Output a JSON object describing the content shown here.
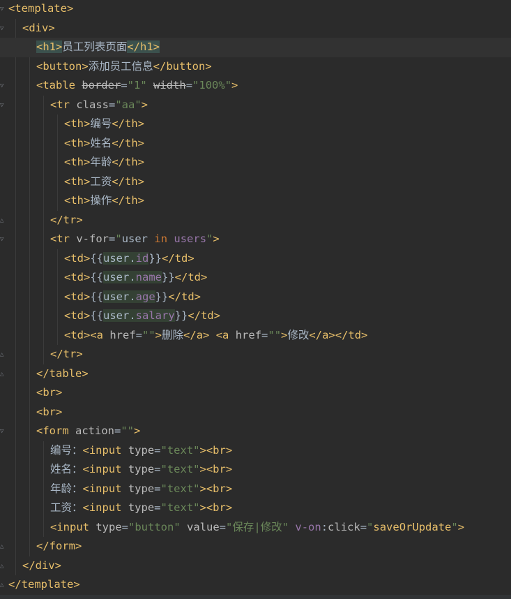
{
  "editor": {
    "lines": [
      {
        "indent": 0,
        "parts": [
          [
            "t",
            "<template>"
          ]
        ]
      },
      {
        "indent": 1,
        "parts": [
          [
            "t",
            "<div>"
          ]
        ]
      },
      {
        "indent": 2,
        "current": true,
        "parts": [
          [
            "t",
            "<h1>",
            "tagmatch"
          ],
          [
            "p",
            "员工列表页面"
          ],
          [
            "t",
            "</h1>",
            "tagmatch"
          ]
        ]
      },
      {
        "indent": 2,
        "parts": [
          [
            "t",
            "<button>"
          ],
          [
            "p",
            "添加员工信息"
          ],
          [
            "t",
            "</button>"
          ]
        ]
      },
      {
        "indent": 2,
        "parts": [
          [
            "t",
            "<table "
          ],
          [
            "strike",
            "border"
          ],
          [
            "p",
            "="
          ],
          [
            "s",
            "\"1\""
          ],
          [
            "p",
            " "
          ],
          [
            "strike",
            "width"
          ],
          [
            "p",
            "="
          ],
          [
            "s",
            "\"100%\""
          ],
          [
            "t",
            ">"
          ]
        ]
      },
      {
        "indent": 3,
        "parts": [
          [
            "t",
            "<tr "
          ],
          [
            "a",
            "class"
          ],
          [
            "p",
            "="
          ],
          [
            "s",
            "\"aa\""
          ],
          [
            "t",
            ">"
          ]
        ]
      },
      {
        "indent": 4,
        "parts": [
          [
            "t",
            "<th>"
          ],
          [
            "p",
            "编号"
          ],
          [
            "t",
            "</th>"
          ]
        ]
      },
      {
        "indent": 4,
        "parts": [
          [
            "t",
            "<th>"
          ],
          [
            "p",
            "姓名"
          ],
          [
            "t",
            "</th>"
          ]
        ]
      },
      {
        "indent": 4,
        "parts": [
          [
            "t",
            "<th>"
          ],
          [
            "p",
            "年龄"
          ],
          [
            "t",
            "</th>"
          ]
        ]
      },
      {
        "indent": 4,
        "parts": [
          [
            "t",
            "<th>"
          ],
          [
            "p",
            "工资"
          ],
          [
            "t",
            "</th>"
          ]
        ]
      },
      {
        "indent": 4,
        "parts": [
          [
            "t",
            "<th>"
          ],
          [
            "p",
            "操作"
          ],
          [
            "t",
            "</th>"
          ]
        ]
      },
      {
        "indent": 3,
        "parts": [
          [
            "t",
            "</tr>"
          ]
        ]
      },
      {
        "indent": 3,
        "parts": [
          [
            "t",
            "<tr "
          ],
          [
            "a",
            "v-for"
          ],
          [
            "p",
            "="
          ],
          [
            "s",
            "\""
          ],
          [
            "p",
            "user "
          ],
          [
            "k",
            "in"
          ],
          [
            "p",
            " "
          ],
          [
            "v",
            "users"
          ],
          [
            "s",
            "\""
          ],
          [
            "t",
            ">"
          ]
        ]
      },
      {
        "indent": 4,
        "parts": [
          [
            "t",
            "<td>"
          ],
          [
            "p",
            "{{"
          ],
          [
            "p",
            "user.",
            "hl"
          ],
          [
            "v",
            "id",
            "hl"
          ],
          [
            "p",
            "}}"
          ],
          [
            "t",
            "</td>"
          ]
        ]
      },
      {
        "indent": 4,
        "parts": [
          [
            "t",
            "<td>"
          ],
          [
            "p",
            "{{"
          ],
          [
            "p",
            "user.",
            "hl"
          ],
          [
            "v",
            "name",
            "hl"
          ],
          [
            "p",
            "}}"
          ],
          [
            "t",
            "</td>"
          ]
        ]
      },
      {
        "indent": 4,
        "parts": [
          [
            "t",
            "<td>"
          ],
          [
            "p",
            "{{"
          ],
          [
            "p",
            "user.",
            "hl"
          ],
          [
            "v",
            "age",
            "hl"
          ],
          [
            "p",
            "}}"
          ],
          [
            "t",
            "</td>"
          ]
        ]
      },
      {
        "indent": 4,
        "parts": [
          [
            "t",
            "<td>"
          ],
          [
            "p",
            "{{"
          ],
          [
            "p",
            "user.",
            "hl"
          ],
          [
            "v",
            "salary",
            "hl"
          ],
          [
            "p",
            "}}"
          ],
          [
            "t",
            "</td>"
          ]
        ]
      },
      {
        "indent": 4,
        "parts": [
          [
            "t",
            "<td><a "
          ],
          [
            "a",
            "href"
          ],
          [
            "p",
            "="
          ],
          [
            "s",
            "\"\""
          ],
          [
            "t",
            ">"
          ],
          [
            "p",
            "删除"
          ],
          [
            "t",
            "</a>"
          ],
          [
            "p",
            " "
          ],
          [
            "t",
            "<a "
          ],
          [
            "a",
            "href"
          ],
          [
            "p",
            "="
          ],
          [
            "s",
            "\"\""
          ],
          [
            "t",
            ">"
          ],
          [
            "p",
            "修改"
          ],
          [
            "t",
            "</a></td>"
          ]
        ]
      },
      {
        "indent": 3,
        "parts": [
          [
            "t",
            "</tr>"
          ]
        ]
      },
      {
        "indent": 2,
        "parts": [
          [
            "t",
            "</table>"
          ]
        ]
      },
      {
        "indent": 2,
        "parts": [
          [
            "t",
            "<br>"
          ]
        ]
      },
      {
        "indent": 2,
        "parts": [
          [
            "t",
            "<br>"
          ]
        ]
      },
      {
        "indent": 2,
        "parts": [
          [
            "t",
            "<form "
          ],
          [
            "a",
            "action"
          ],
          [
            "p",
            "="
          ],
          [
            "s",
            "\"\""
          ],
          [
            "t",
            ">"
          ]
        ]
      },
      {
        "indent": 3,
        "parts": [
          [
            "p",
            "编号："
          ],
          [
            "t",
            "<input "
          ],
          [
            "a",
            "type"
          ],
          [
            "p",
            "="
          ],
          [
            "s",
            "\"text\""
          ],
          [
            "t",
            "><br>"
          ]
        ]
      },
      {
        "indent": 3,
        "parts": [
          [
            "p",
            "姓名："
          ],
          [
            "t",
            "<input "
          ],
          [
            "a",
            "type"
          ],
          [
            "p",
            "="
          ],
          [
            "s",
            "\"text\""
          ],
          [
            "t",
            "><br>"
          ]
        ]
      },
      {
        "indent": 3,
        "parts": [
          [
            "p",
            "年龄："
          ],
          [
            "t",
            "<input "
          ],
          [
            "a",
            "type"
          ],
          [
            "p",
            "="
          ],
          [
            "s",
            "\"text\""
          ],
          [
            "t",
            "><br>"
          ]
        ]
      },
      {
        "indent": 3,
        "parts": [
          [
            "p",
            "工资："
          ],
          [
            "t",
            "<input "
          ],
          [
            "a",
            "type"
          ],
          [
            "p",
            "="
          ],
          [
            "s",
            "\"text\""
          ],
          [
            "t",
            "><br>"
          ]
        ]
      },
      {
        "indent": 3,
        "parts": [
          [
            "t",
            "<input "
          ],
          [
            "a",
            "type"
          ],
          [
            "p",
            "="
          ],
          [
            "s",
            "\"button\""
          ],
          [
            "p",
            " "
          ],
          [
            "a",
            "value"
          ],
          [
            "p",
            "="
          ],
          [
            "s",
            "\"保存|修改\""
          ],
          [
            "p",
            " "
          ],
          [
            "v",
            "v-on"
          ],
          [
            "p",
            ":"
          ],
          [
            "a",
            "click"
          ],
          [
            "p",
            "="
          ],
          [
            "s",
            "\""
          ],
          [
            "t",
            "saveOrUpdate"
          ],
          [
            "s",
            "\""
          ],
          [
            "t",
            ">"
          ]
        ]
      },
      {
        "indent": 2,
        "parts": [
          [
            "t",
            "</form>"
          ]
        ]
      },
      {
        "indent": 1,
        "parts": [
          [
            "t",
            "</div>"
          ]
        ]
      },
      {
        "indent": 0,
        "parts": [
          [
            "t",
            "</template>"
          ]
        ]
      }
    ]
  },
  "colors": {
    "background": "#2b2b2b",
    "tag": "#e8bf6a",
    "attribute": "#bababa",
    "string": "#6a8759",
    "directive": "#9876aa",
    "keyword": "#cc7832",
    "plain": "#a9b7c6"
  },
  "icons": {
    "fold_open": "fold-open-icon",
    "fold_close": "fold-close-icon"
  }
}
